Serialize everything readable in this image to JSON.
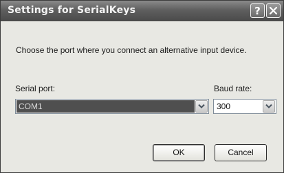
{
  "window": {
    "title": "Settings for SerialKeys",
    "help_label": "?"
  },
  "instructions": "Choose the port where you connect an alternative input device.",
  "serial_port": {
    "label": "Serial port:",
    "value": "COM1"
  },
  "baud_rate": {
    "label": "Baud rate:",
    "value": "300"
  },
  "buttons": {
    "ok": "OK",
    "cancel": "Cancel"
  },
  "icons": {
    "close": "close-icon",
    "dropdown": "chevron-down-icon"
  }
}
